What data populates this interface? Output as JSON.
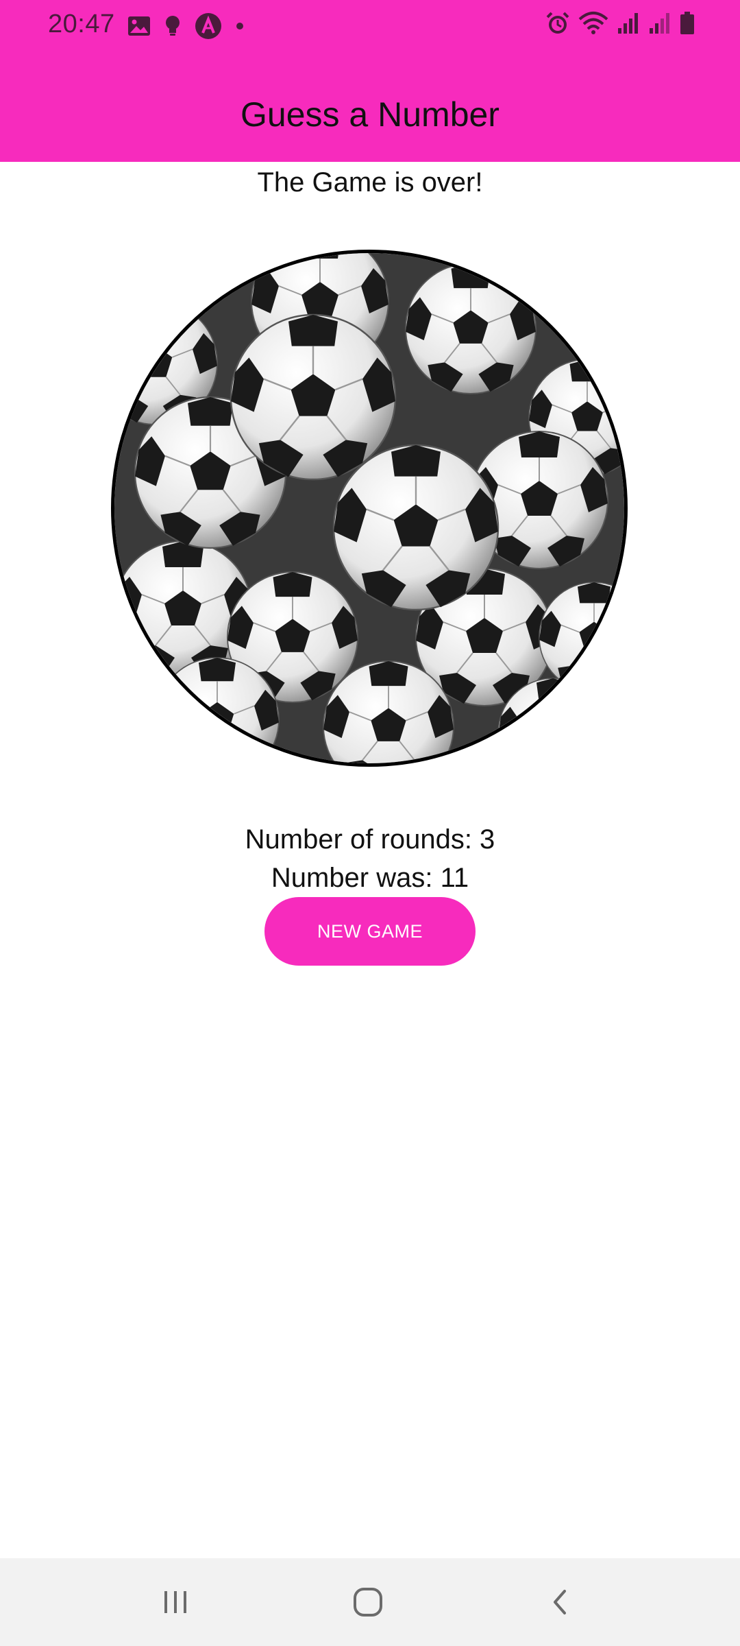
{
  "status_bar": {
    "time": "20:47",
    "left_icons": [
      "gallery-icon",
      "bulb-icon",
      "app-a-icon",
      "dot-icon"
    ],
    "right_icons": [
      "alarm-icon",
      "wifi-icon",
      "signal-icon",
      "signal-icon",
      "battery-icon"
    ]
  },
  "header": {
    "title": "Guess a Number",
    "color": "#f72bbd"
  },
  "main": {
    "game_over_text": "The Game is over!",
    "image_icon": "soccer-balls-image",
    "rounds_label": "Number of rounds: 3",
    "number_label": "Number was: 11",
    "new_game_label": "NEW GAME"
  },
  "nav_bar": {
    "buttons": [
      "recent-apps-icon",
      "home-icon",
      "back-icon"
    ]
  },
  "colors": {
    "accent": "#f72bbd",
    "text": "#111111",
    "nav_background": "#f2f2f2"
  }
}
